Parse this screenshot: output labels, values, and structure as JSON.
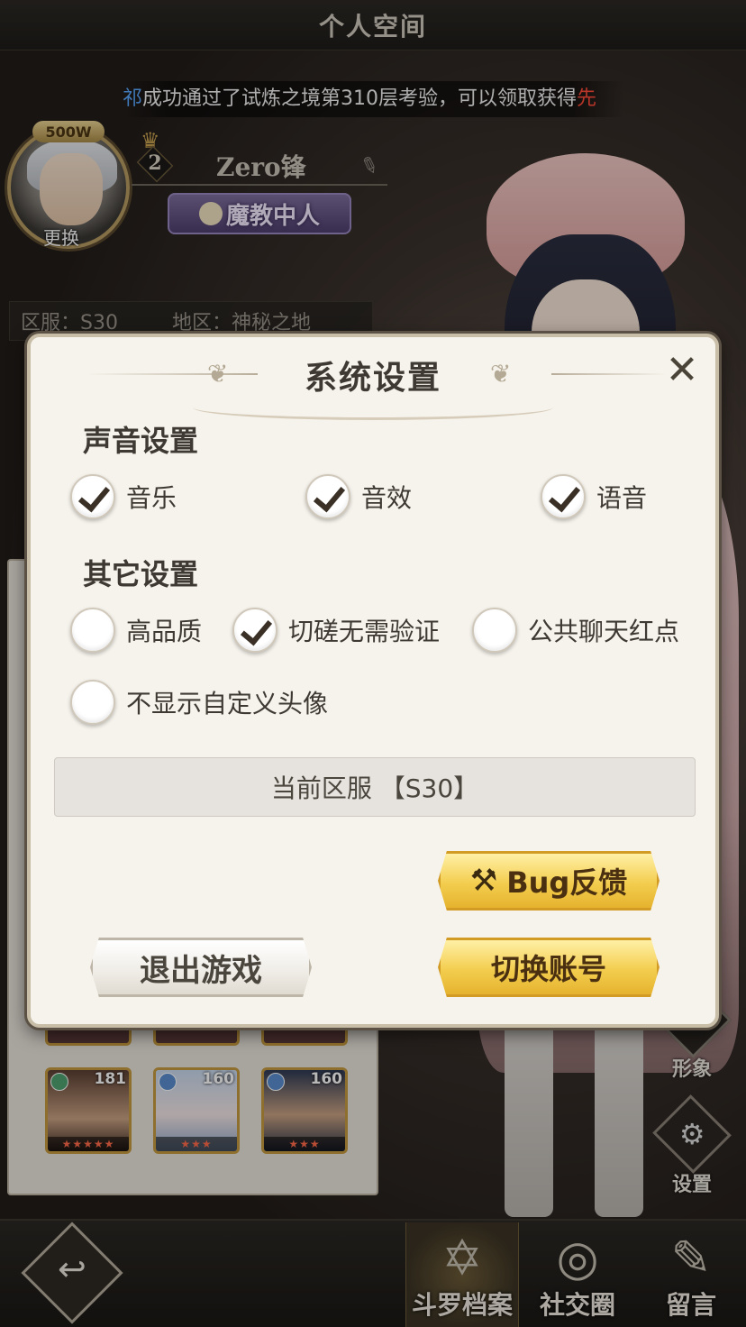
{
  "screen": {
    "title": "个人空间",
    "marquee": {
      "name_part": "祁",
      "message": "成功通过了试炼之境第310层考验，可以领取获得",
      "highlight": "先"
    },
    "profile": {
      "badge": "500W",
      "change_label": "更换",
      "level": "2",
      "player_name": "Zero锋",
      "title_plaque": "魔教中人",
      "server_label": "区服：S30",
      "region_label": "地区：神秘之地"
    },
    "heroes": [
      {
        "level": "181",
        "stars": "★★★★★",
        "elem_color": "#4ea36f"
      },
      {
        "level": "160",
        "stars": "★★★",
        "elem_color": "#4a86cf"
      },
      {
        "level": "160",
        "stars": "★★★",
        "elem_color": "#4a86cf"
      }
    ],
    "side_buttons": {
      "appearance": "形象",
      "settings": "设置"
    },
    "bottom_tabs": [
      {
        "label": "斗罗档案",
        "active": true
      },
      {
        "label": "社交圈",
        "active": false
      },
      {
        "label": "留言",
        "active": false
      }
    ]
  },
  "settings_dialog": {
    "title": "系统设置",
    "sound_section": "声音设置",
    "sound_options": [
      {
        "label": "音乐",
        "checked": true
      },
      {
        "label": "音效",
        "checked": true
      },
      {
        "label": "语音",
        "checked": true
      }
    ],
    "other_section": "其它设置",
    "other_options": [
      {
        "label": "高品质",
        "checked": false
      },
      {
        "label": "切磋无需验证",
        "checked": true
      },
      {
        "label": "公共聊天红点",
        "checked": false
      },
      {
        "label": "不显示自定义头像",
        "checked": false
      }
    ],
    "current_server": "当前区服 【S30】",
    "bug_button": "Bug反馈",
    "switch_account_button": "切换账号",
    "exit_button": "退出游戏"
  },
  "colors": {
    "gold_button": "#f3cd4e",
    "modal_bg": "#f6f3ec",
    "marquee_name": "#5aa8ff",
    "marquee_highlight": "#ff4a3a"
  }
}
